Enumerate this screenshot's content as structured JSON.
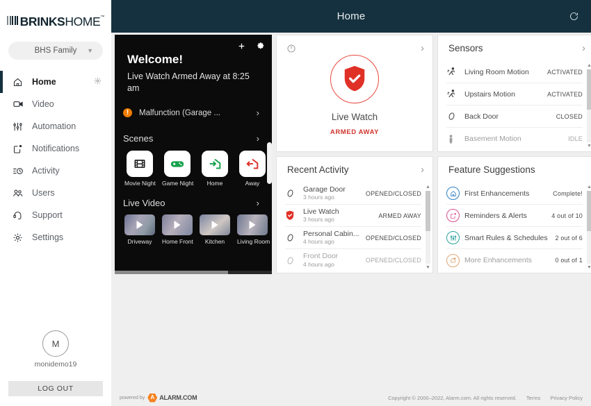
{
  "header": {
    "title": "Home",
    "refresh_icon": "refresh-icon"
  },
  "brand": {
    "bold": "BRINKS",
    "light": "HOME",
    "tm": "™"
  },
  "sidebar": {
    "family_selector": {
      "label": "BHS Family",
      "chevron": "chevron-down-icon"
    },
    "items": [
      {
        "label": "Home",
        "icon": "home-icon",
        "active": true,
        "gear": "gear-icon"
      },
      {
        "label": "Video",
        "icon": "video-camera-icon",
        "active": false
      },
      {
        "label": "Automation",
        "icon": "sliders-icon",
        "active": false
      },
      {
        "label": "Notifications",
        "icon": "notification-icon",
        "active": false
      },
      {
        "label": "Activity",
        "icon": "activity-icon",
        "active": false
      },
      {
        "label": "Users",
        "icon": "users-icon",
        "active": false
      },
      {
        "label": "Support",
        "icon": "headset-icon",
        "active": false
      },
      {
        "label": "Settings",
        "icon": "gear-icon",
        "active": false
      }
    ],
    "user": {
      "initial": "M",
      "name": "monidemo19"
    },
    "logout_label": "LOG OUT"
  },
  "welcome": {
    "add_icon": "plus-icon",
    "settings_icon": "gear-icon",
    "title": "Welcome!",
    "subtitle": "Live Watch Armed Away at 8:25 am",
    "alert": {
      "icon": "warning-icon",
      "text": "Malfunction (Garage ...",
      "chevron": "chevron-right-icon"
    },
    "scenes_title": "Scenes",
    "scenes": [
      {
        "label": "Movie Night",
        "icon": "film-icon"
      },
      {
        "label": "Game Night",
        "icon": "gamepad-icon"
      },
      {
        "label": "Home",
        "icon": "arrow-into-house-icon"
      },
      {
        "label": "Away",
        "icon": "arrow-out-of-house-icon"
      }
    ],
    "live_video_title": "Live Video",
    "videos": [
      {
        "label": "Driveway",
        "icon": "play-icon"
      },
      {
        "label": "Home Front",
        "icon": "play-icon"
      },
      {
        "label": "Kitchen",
        "icon": "play-icon"
      },
      {
        "label": "Living Room",
        "icon": "play-icon"
      }
    ]
  },
  "live_watch": {
    "power_icon": "power-icon",
    "chevron": "chevron-right-icon",
    "shield_icon": "shield-check-icon",
    "name": "Live Watch",
    "status": "ARMED AWAY",
    "accent": "#d0342c"
  },
  "sensors": {
    "title": "Sensors",
    "chevron": "chevron-right-icon",
    "items": [
      {
        "name": "Living Room Motion",
        "state": "ACTIVATED",
        "icon": "motion-sensor-icon",
        "dim": false
      },
      {
        "name": "Upstairs Motion",
        "state": "ACTIVATED",
        "icon": "motion-sensor-icon",
        "dim": false
      },
      {
        "name": "Back Door",
        "state": "CLOSED",
        "icon": "door-sensor-icon",
        "dim": false
      },
      {
        "name": "Basement Motion",
        "state": "IDLE",
        "icon": "person-icon",
        "dim": true
      }
    ]
  },
  "recent_activity": {
    "title": "Recent Activity",
    "chevron": "chevron-right-icon",
    "items": [
      {
        "name": "Garage Door",
        "time": "3 hours ago",
        "state": "OPENED/CLOSED",
        "icon": "door-sensor-icon",
        "dim": false
      },
      {
        "name": "Live Watch",
        "time": "3 hours ago",
        "state": "ARMED AWAY",
        "icon": "shield-check-icon",
        "dim": false
      },
      {
        "name": "Personal Cabin...",
        "time": "4 hours ago",
        "state": "OPENED/CLOSED",
        "icon": "door-sensor-icon",
        "dim": false
      },
      {
        "name": "Front Door",
        "time": "4 hours ago",
        "state": "OPENED/CLOSED",
        "icon": "door-sensor-icon",
        "dim": true
      }
    ]
  },
  "feature_suggestions": {
    "title": "Feature Suggestions",
    "items": [
      {
        "name": "First Enhancements",
        "value": "Complete!",
        "icon": "home-badge-icon",
        "color": "#2e7fc1",
        "dim": false
      },
      {
        "name": "Reminders & Alerts",
        "value": "4 out of 10",
        "icon": "notification-badge-icon",
        "color": "#d94f8c",
        "dim": false
      },
      {
        "name": "Smart Rules & Schedules",
        "value": "2 out of 6",
        "icon": "sliders-badge-icon",
        "color": "#2aa19b",
        "dim": false
      },
      {
        "name": "More Enhancements",
        "value": "0 out of 1",
        "icon": "sparkle-badge-icon",
        "color": "#e08b3a",
        "dim": true
      }
    ]
  },
  "footer": {
    "powered_by": "powered by",
    "alarm_brand": "ALARM.COM",
    "copyright": "Copyright © 2000–2022, Alarm.com. All rights reserved.",
    "terms": "Terms",
    "privacy": "Privacy Policy"
  }
}
